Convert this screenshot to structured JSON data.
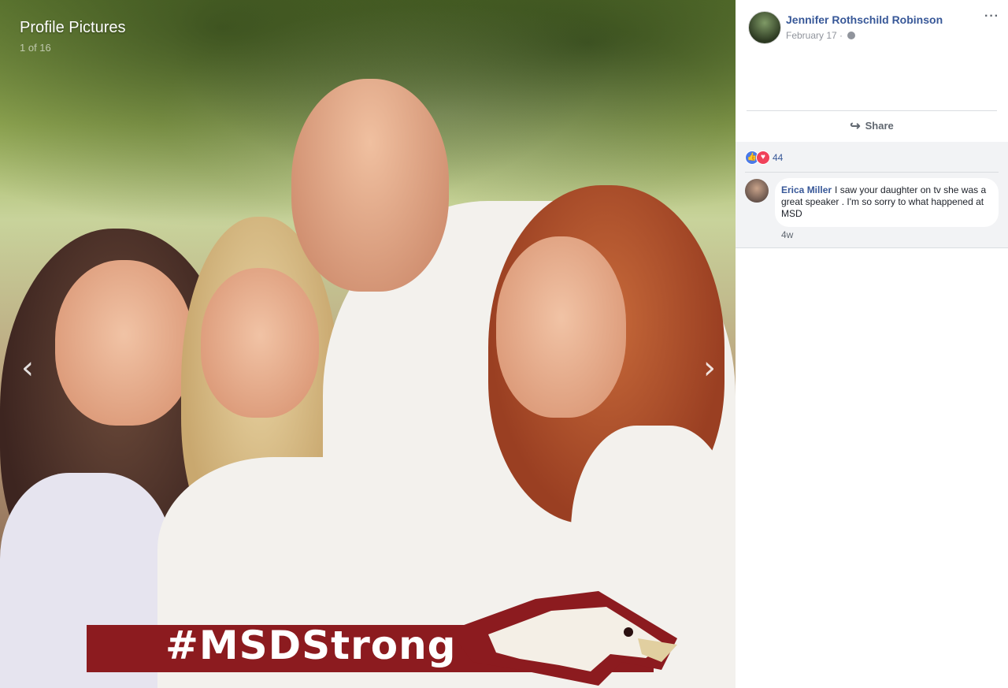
{
  "viewer": {
    "album_title": "Profile Pictures",
    "album_count": "1 of 16",
    "banner_text": "#MSDStrong",
    "prev_icon": "chevron-left-icon",
    "next_icon": "chevron-right-icon"
  },
  "post": {
    "author": "Jennifer Rothschild Robinson",
    "date": "February 17 · ",
    "more_icon": "more-options-icon",
    "share_label": "Share",
    "reaction_count": "44"
  },
  "comment": {
    "name": "Erica Miller",
    "text": "I saw your daughter on tv she was a great speaker . I'm so sorry to what happened at MSD",
    "time": "4w"
  },
  "colors": {
    "link_blue": "#385898",
    "banner_red": "#8c1b1f",
    "like_blue": "#4a7ae8",
    "love_red": "#f0425a"
  }
}
